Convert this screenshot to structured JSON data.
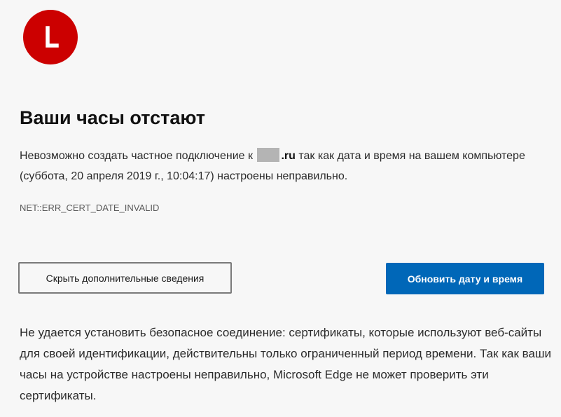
{
  "error_page": {
    "icon": "alert-circle-icon",
    "icon_color": "#cc0000",
    "title": "Ваши часы отстают",
    "description": {
      "prefix": "Невозможно создать частное подключение к ",
      "domain_suffix": ".ru",
      "suffix": " так как дата и время на вашем компьютере (суббота, 20 апреля 2019 г., 10:04:17) настроены неправильно."
    },
    "error_code": "NET::ERR_CERT_DATE_INVALID",
    "buttons": {
      "hide_details": "Скрыть дополнительные сведения",
      "update_datetime": "Обновить дату и время"
    },
    "accent_color": "#0067b8",
    "details": "Не удается установить безопасное соединение: сертификаты, которые используют веб-сайты для своей идентификации, действительны только ограниченный период времени. Так как ваши часы на устройстве настроены неправильно, Microsoft Edge не может проверить эти сертификаты."
  }
}
